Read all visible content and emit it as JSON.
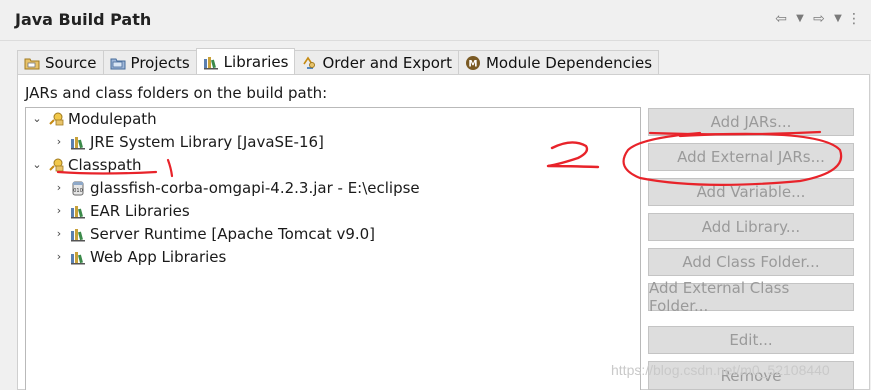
{
  "header": {
    "title": "Java Build Path"
  },
  "tabs": [
    {
      "label": "Source",
      "icon": "source-folder-icon",
      "active": false
    },
    {
      "label": "Projects",
      "icon": "projects-icon",
      "active": false
    },
    {
      "label": "Libraries",
      "icon": "libraries-icon",
      "active": true
    },
    {
      "label": "Order and Export",
      "icon": "order-export-icon",
      "active": false
    },
    {
      "label": "Module Dependencies",
      "icon": "module-icon",
      "active": false
    }
  ],
  "description": "JARs and class folders on the build path:",
  "tree": [
    {
      "label": "Modulepath",
      "expander": "expanded",
      "icon": "container-icon"
    },
    {
      "label": "JRE System Library [JavaSE-16]",
      "expander": "collapsed",
      "icon": "library-icon"
    },
    {
      "label": "Classpath",
      "expander": "expanded",
      "icon": "container-icon"
    },
    {
      "label": "glassfish-corba-omgapi-4.2.3.jar - E:\\eclipse",
      "expander": "collapsed",
      "icon": "jar-icon"
    },
    {
      "label": "EAR Libraries",
      "expander": "collapsed",
      "icon": "library-icon"
    },
    {
      "label": "Server Runtime [Apache Tomcat v9.0]",
      "expander": "collapsed",
      "icon": "library-icon"
    },
    {
      "label": "Web App Libraries",
      "expander": "collapsed",
      "icon": "library-icon"
    }
  ],
  "buttons": [
    "Add JARs...",
    "Add External JARs...",
    "Add Variable...",
    "Add Library...",
    "Add Class Folder...",
    "Add External Class Folder...",
    "Edit...",
    "Remove"
  ],
  "annotations": {
    "mark1": "1",
    "mark2": "2",
    "annotation_color": "#e8232a"
  },
  "watermark": "https://blog.csdn.net/m0_52108440"
}
